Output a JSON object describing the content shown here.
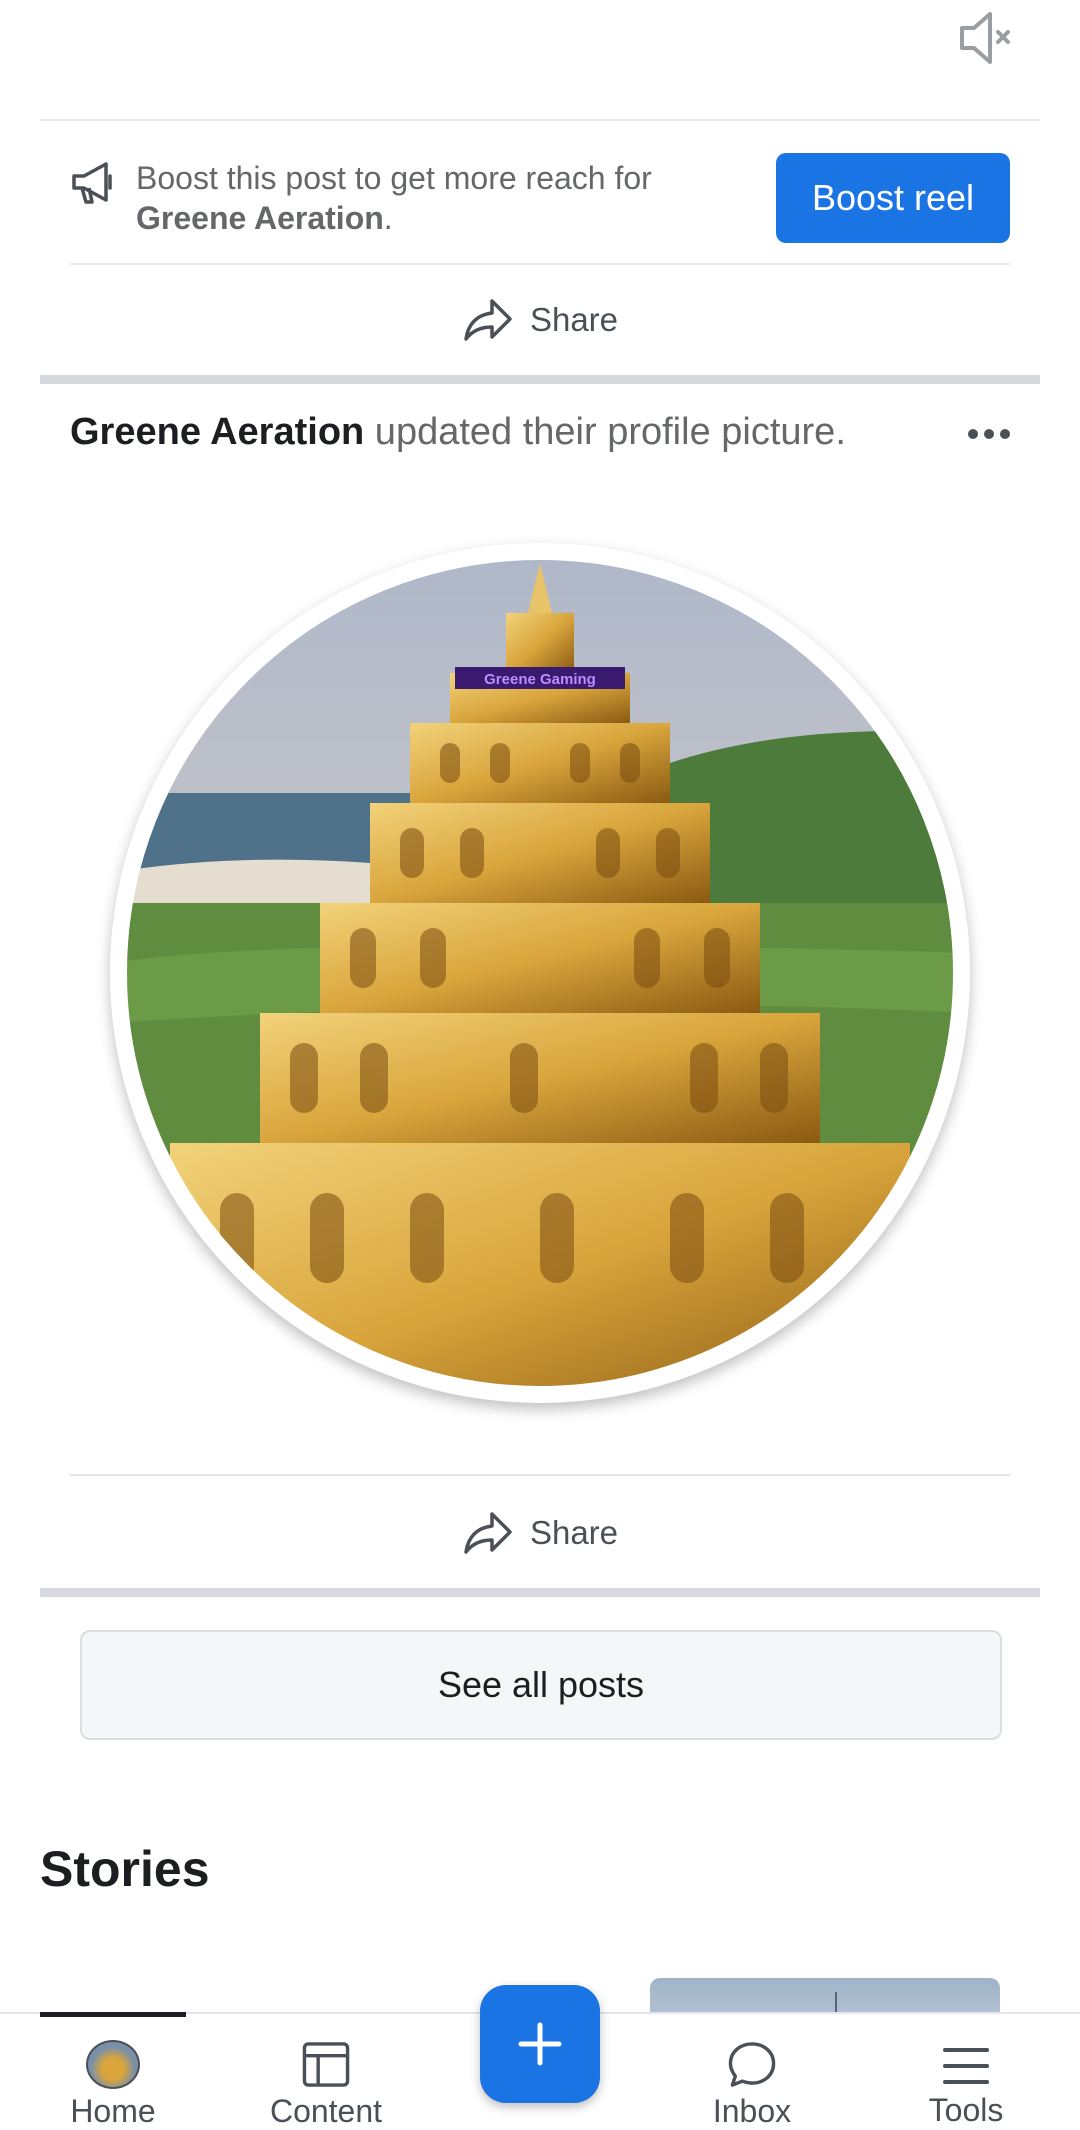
{
  "boost": {
    "prefix": "Boost this post to get more reach for ",
    "page_name": "Greene Aeration",
    "suffix": ".",
    "button_label": "Boost reel"
  },
  "share_label": "Share",
  "post": {
    "author": "Greene Aeration",
    "action": " updated their profile picture.",
    "image_sign_text": "Greene Gaming"
  },
  "see_all_label": "See all posts",
  "stories": {
    "title": "Stories"
  },
  "nav": {
    "items": [
      {
        "label": "Home",
        "icon": "home-avatar-icon"
      },
      {
        "label": "Content",
        "icon": "content-icon"
      },
      {
        "label": "Inbox",
        "icon": "chat-bubble-icon"
      },
      {
        "label": "Tools",
        "icon": "menu-icon"
      }
    ],
    "fab_icon": "plus-icon"
  }
}
